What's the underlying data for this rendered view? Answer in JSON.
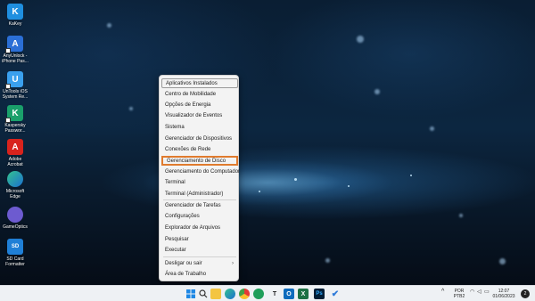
{
  "desktop": {
    "icons": [
      {
        "label": "KaKey"
      },
      {
        "label": "AnyUnlock - iPhone Pas..."
      },
      {
        "label": "UnTools iOS System Re..."
      },
      {
        "label": "Kaspersky Passwor..."
      },
      {
        "label": "Adobe Acrobat"
      },
      {
        "label": "Microsoft Edge"
      },
      {
        "label": "GameOptics"
      },
      {
        "label": "SD Card Formatter"
      }
    ]
  },
  "context_menu": {
    "items": [
      {
        "label": "Aplicativos Instalados"
      },
      {
        "label": "Centro de Mobilidade"
      },
      {
        "label": "Opções de Energia"
      },
      {
        "label": "Visualizador de Eventos"
      },
      {
        "label": "Sistema"
      },
      {
        "label": "Gerenciador de Dispositivos"
      },
      {
        "label": "Conexões de Rede"
      },
      {
        "label": "Gerenciamento de Disco"
      },
      {
        "label": "Gerenciamento do Computador"
      },
      {
        "label": "Terminal"
      },
      {
        "label": "Terminal (Administrador)"
      },
      {
        "label": "Gerenciador de Tarefas"
      },
      {
        "label": "Configurações"
      },
      {
        "label": "Explorador de Arquivos"
      },
      {
        "label": "Pesquisar"
      },
      {
        "label": "Executar"
      },
      {
        "label": "Desligar ou sair"
      },
      {
        "label": "Área de Trabalho"
      }
    ],
    "highlighted": "Gerenciamento de Disco",
    "highlight_color": "#e07b2e"
  },
  "taskbar": {
    "apps": [
      {
        "icon": "windows-start-icon"
      },
      {
        "icon": "search-icon"
      },
      {
        "icon": "file-explorer-icon"
      },
      {
        "icon": "edge-icon"
      },
      {
        "icon": "chrome-icon"
      },
      {
        "icon": "green-app-icon"
      },
      {
        "icon": "typora-icon",
        "glyph": "T"
      },
      {
        "icon": "outlook-icon"
      },
      {
        "icon": "excel-icon"
      },
      {
        "icon": "photoshop-icon",
        "glyph": "Ps"
      },
      {
        "icon": "todo-icon"
      }
    ],
    "tray": {
      "lang_top": "POR",
      "lang_bottom": "PTB2",
      "time": "12:07",
      "date": "01/06/2023",
      "notifications": "2"
    }
  }
}
